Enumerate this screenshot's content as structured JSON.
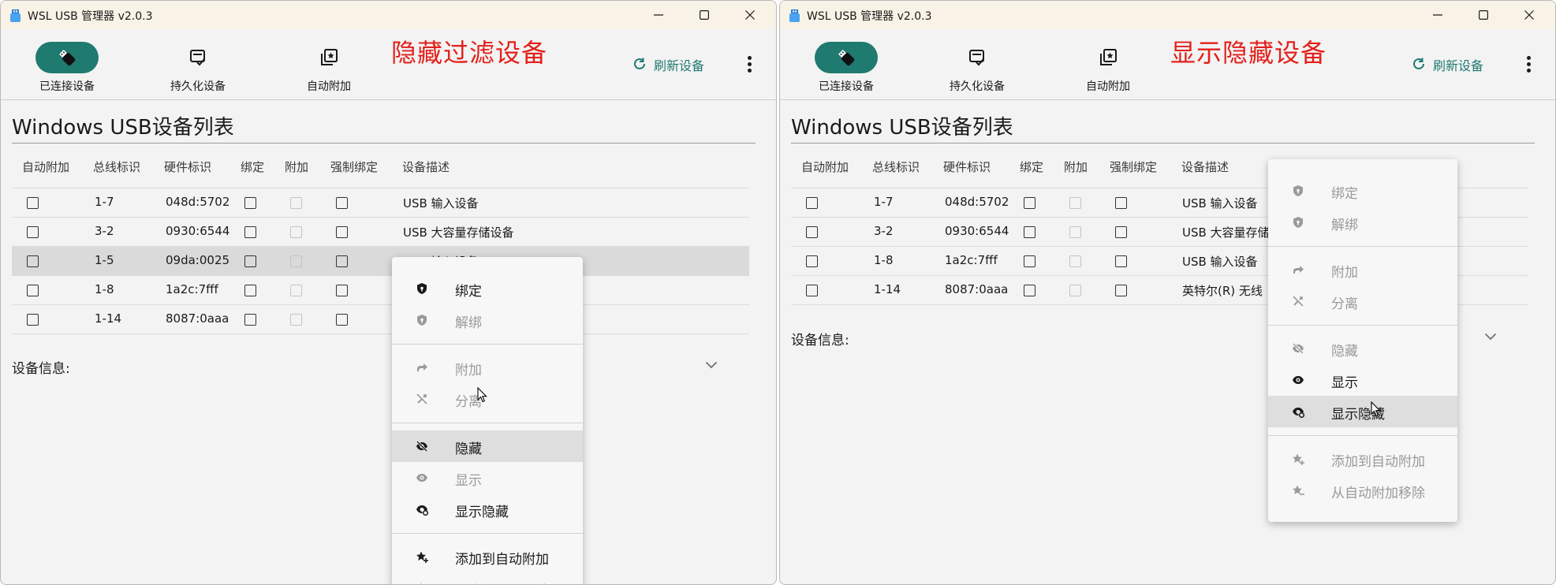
{
  "app": {
    "title": "WSL USB 管理器 v2.0.3",
    "accent_color": "#1f7a70",
    "annotation_color": "#e3201b"
  },
  "nav": {
    "connected": "已连接设备",
    "persisted": "持久化设备",
    "autoattach": "自动附加",
    "refresh": "刷新设备"
  },
  "section": {
    "title": "Windows USB设备列表",
    "device_info": "设备信息:"
  },
  "columns": [
    "自动附加",
    "总线标识",
    "硬件标识",
    "绑定",
    "附加",
    "强制绑定",
    "设备描述"
  ],
  "menu_labels": {
    "bind": "绑定",
    "unbind": "解绑",
    "attach": "附加",
    "detach": "分离",
    "hide": "隐藏",
    "show": "显示",
    "show_hidden": "显示隐藏",
    "add_auto": "添加到自动附加",
    "remove_auto": "从自动附加移除"
  },
  "left": {
    "annotation": "隐藏过滤设备",
    "rows": [
      {
        "busid": "1-7",
        "hwid": "048d:5702",
        "desc": "USB 输入设备"
      },
      {
        "busid": "3-2",
        "hwid": "0930:6544",
        "desc": "USB 大容量存储设备"
      },
      {
        "busid": "1-5",
        "hwid": "09da:0025",
        "desc": "USB 输入设备"
      },
      {
        "busid": "1-8",
        "hwid": "1a2c:7fff",
        "desc": ""
      },
      {
        "busid": "1-14",
        "hwid": "8087:0aaa",
        "desc": ""
      }
    ],
    "selected_row": 2,
    "menu_state": {
      "bind": "enabled",
      "unbind": "disabled",
      "attach": "disabled",
      "detach": "disabled",
      "hide": "enabled-highlighted",
      "show": "disabled",
      "show_hidden": "enabled",
      "add_auto": "enabled",
      "remove_auto": "disabled"
    }
  },
  "right": {
    "annotation": "显示隐藏设备",
    "rows": [
      {
        "busid": "1-7",
        "hwid": "048d:5702",
        "desc": "USB 输入设备"
      },
      {
        "busid": "3-2",
        "hwid": "0930:6544",
        "desc": "USB 大容量存储"
      },
      {
        "busid": "1-8",
        "hwid": "1a2c:7fff",
        "desc": "USB 输入设备"
      },
      {
        "busid": "1-14",
        "hwid": "8087:0aaa",
        "desc": "英特尔(R) 无线"
      }
    ],
    "menu_state": {
      "bind": "disabled",
      "unbind": "disabled",
      "attach": "disabled",
      "detach": "disabled",
      "hide": "disabled",
      "show": "enabled",
      "show_hidden": "enabled-highlighted",
      "add_auto": "disabled",
      "remove_auto": "disabled"
    }
  },
  "icons": {
    "app": "usb-app-icon",
    "nav_connected": "usb-plug-icon",
    "nav_persisted": "persist-icon",
    "nav_autoattach": "auto-attach-icon",
    "refresh": "refresh-icon",
    "more": "more-vert-icon",
    "bind": "shield-icon",
    "unbind": "shield-open-icon",
    "attach": "arrow-forward-icon",
    "detach": "link-off-icon",
    "hide": "eye-off-icon",
    "show": "eye-icon",
    "show_hidden": "eye-refresh-icon",
    "add_auto": "star-add-icon",
    "remove_auto": "star-remove-icon"
  }
}
